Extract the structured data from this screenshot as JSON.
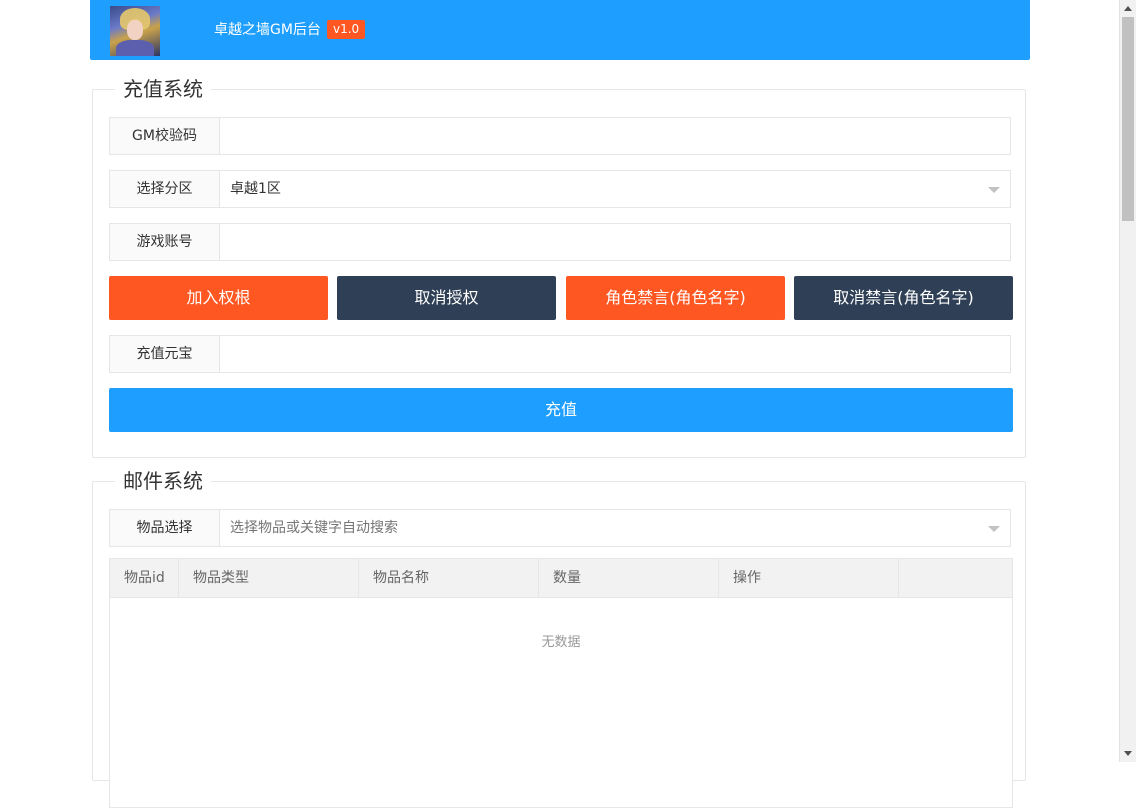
{
  "header": {
    "title": "卓越之墙GM后台",
    "version": "v1.0",
    "avatar_icon": "game-character-avatar"
  },
  "recharge": {
    "legend": "充值系统",
    "gm_code_label": "GM校验码",
    "gm_code_value": "",
    "zone_label": "选择分区",
    "zone_value": "卓越1区",
    "account_label": "游戏账号",
    "account_value": "",
    "buttons": {
      "add_auth": "加入权根",
      "cancel_auth": "取消授权",
      "mute_role": "角色禁言(角色名字)",
      "unmute_role": "取消禁言(角色名字)"
    },
    "ingot_label": "充值元宝",
    "ingot_value": "",
    "submit": "充值"
  },
  "mail": {
    "legend": "邮件系统",
    "item_label": "物品选择",
    "item_placeholder": "选择物品或关键字自动搜索",
    "table": {
      "columns": [
        "物品id",
        "物品类型",
        "物品名称",
        "数量",
        "操作"
      ],
      "rows": [],
      "empty_text": "无数据"
    }
  },
  "colors": {
    "primary": "#1e9fff",
    "orange": "#ff5722",
    "dark": "#2f4056",
    "border": "#e6e6e6"
  }
}
